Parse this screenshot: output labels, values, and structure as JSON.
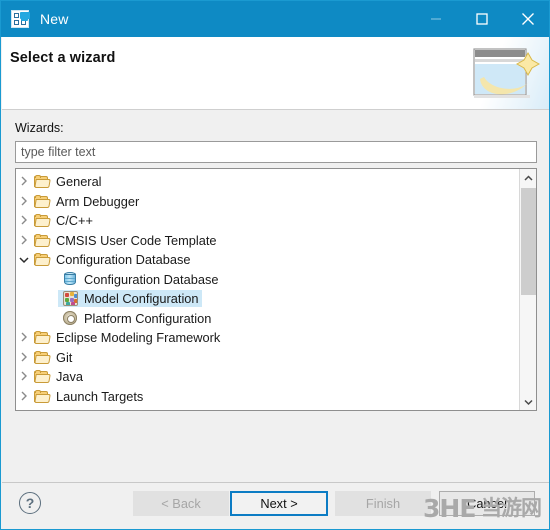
{
  "window": {
    "title": "New",
    "icon": "new-wizard-icon",
    "accent_color": "#0e8ac4",
    "controls": [
      {
        "name": "minimize",
        "glyph": "minimize-icon"
      },
      {
        "name": "maximize",
        "glyph": "maximize-icon"
      },
      {
        "name": "close",
        "glyph": "close-icon"
      }
    ]
  },
  "header": {
    "title": "Select a wizard",
    "art": "wizard-banner-image"
  },
  "body": {
    "wizards_label": "Wizards:",
    "filter": {
      "value": "",
      "placeholder": "type filter text"
    },
    "tree": [
      {
        "label": "General",
        "icon": "folder-icon",
        "level": 0,
        "expander": "collapsed",
        "selected": false
      },
      {
        "label": "Arm Debugger",
        "icon": "folder-icon",
        "level": 0,
        "expander": "collapsed",
        "selected": false
      },
      {
        "label": "C/C++",
        "icon": "folder-icon",
        "level": 0,
        "expander": "collapsed",
        "selected": false
      },
      {
        "label": "CMSIS User Code Template",
        "icon": "folder-icon",
        "level": 0,
        "expander": "collapsed",
        "selected": false
      },
      {
        "label": "Configuration Database",
        "icon": "folder-icon",
        "level": 0,
        "expander": "expanded",
        "selected": false
      },
      {
        "label": "Configuration Database",
        "icon": "database-icon",
        "level": 1,
        "expander": "none",
        "selected": false
      },
      {
        "label": "Model Configuration",
        "icon": "model-configuration-icon",
        "level": 1,
        "expander": "none",
        "selected": true
      },
      {
        "label": "Platform Configuration",
        "icon": "gear-icon",
        "level": 1,
        "expander": "none",
        "selected": false
      },
      {
        "label": "Eclipse Modeling Framework",
        "icon": "folder-icon",
        "level": 0,
        "expander": "collapsed",
        "selected": false
      },
      {
        "label": "Git",
        "icon": "folder-icon",
        "level": 0,
        "expander": "collapsed",
        "selected": false
      },
      {
        "label": "Java",
        "icon": "folder-icon",
        "level": 0,
        "expander": "collapsed",
        "selected": false
      },
      {
        "label": "Launch Targets",
        "icon": "folder-icon",
        "level": 0,
        "expander": "collapsed",
        "selected": false
      }
    ],
    "scrollbar": {
      "up_arrow": "chevron-up-icon",
      "down_arrow": "chevron-down-icon",
      "thumb_color": "#cdcdcd"
    },
    "selection_color": "#cde8f7"
  },
  "footer": {
    "help_glyph": "?",
    "buttons": [
      {
        "label": "< Back",
        "state": "disabled"
      },
      {
        "label": "Next >",
        "state": "default"
      },
      {
        "label": "Finish",
        "state": "disabled"
      },
      {
        "label": "Cancel",
        "state": "enabled"
      }
    ]
  },
  "watermark": {
    "latin": "3HE",
    "cjk": "当游网"
  }
}
